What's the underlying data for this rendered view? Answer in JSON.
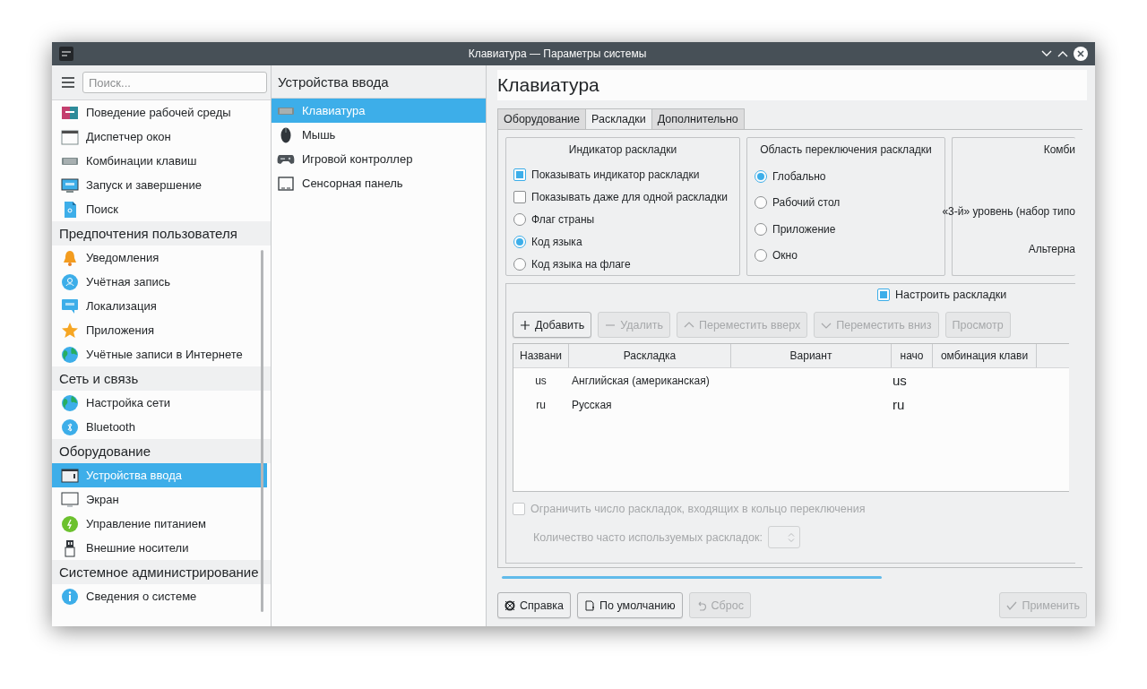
{
  "window": {
    "title": "Клавиатура — Параметры системы"
  },
  "sidebar": {
    "search": {
      "placeholder": "Поиск..."
    },
    "items": [
      {
        "kind": "item",
        "label": "Поведение рабочей среды",
        "selected": false
      },
      {
        "kind": "item",
        "label": "Диспетчер окон",
        "selected": false
      },
      {
        "kind": "item",
        "label": "Комбинации клавиш",
        "selected": false
      },
      {
        "kind": "item",
        "label": "Запуск и завершение",
        "selected": false
      },
      {
        "kind": "item",
        "label": "Поиск",
        "selected": false
      },
      {
        "kind": "category",
        "label": "Предпочтения пользователя"
      },
      {
        "kind": "item",
        "label": "Уведомления",
        "selected": false
      },
      {
        "kind": "item",
        "label": "Учётная запись",
        "selected": false
      },
      {
        "kind": "item",
        "label": "Локализация",
        "selected": false
      },
      {
        "kind": "item",
        "label": "Приложения",
        "selected": false
      },
      {
        "kind": "item",
        "label": "Учётные записи в Интернете",
        "selected": false
      },
      {
        "kind": "category",
        "label": "Сеть и связь"
      },
      {
        "kind": "item",
        "label": "Настройка сети",
        "selected": false
      },
      {
        "kind": "item",
        "label": "Bluetooth",
        "selected": false
      },
      {
        "kind": "category",
        "label": "Оборудование"
      },
      {
        "kind": "item",
        "label": "Устройства ввода",
        "selected": true
      },
      {
        "kind": "item",
        "label": "Экран",
        "selected": false
      },
      {
        "kind": "item",
        "label": "Управление питанием",
        "selected": false
      },
      {
        "kind": "item",
        "label": "Внешние носители",
        "selected": false
      },
      {
        "kind": "category",
        "label": "Системное администрирование"
      },
      {
        "kind": "item",
        "label": "Сведения о системе",
        "selected": false
      }
    ]
  },
  "subcategory": {
    "title": "Устройства ввода",
    "items": [
      {
        "label": "Клавиатура",
        "selected": true
      },
      {
        "label": "Мышь",
        "selected": false
      },
      {
        "label": "Игровой контроллер",
        "selected": false
      },
      {
        "label": "Сенсорная панель",
        "selected": false
      }
    ]
  },
  "page": {
    "title": "Клавиатура",
    "tabs": [
      {
        "label": "Оборудование",
        "selected": false
      },
      {
        "label": "Раскладки",
        "selected": true
      },
      {
        "label": "Дополнительно",
        "selected": false
      }
    ],
    "indicator_group": {
      "title": "Индикатор раскладки",
      "options": [
        {
          "kind": "checkbox",
          "label": "Показывать индикатор раскладки",
          "checked": true
        },
        {
          "kind": "checkbox",
          "label": "Показывать даже для одной раскладки",
          "checked": false
        },
        {
          "kind": "radio",
          "label": "Флаг страны",
          "selected": false
        },
        {
          "kind": "radio",
          "label": "Код языка",
          "selected": true
        },
        {
          "kind": "radio",
          "label": "Код языка на флаге",
          "selected": false
        }
      ]
    },
    "switching_group": {
      "title": "Область переключения раскладки",
      "options": [
        {
          "label": "Глобально",
          "selected": true
        },
        {
          "label": "Рабочий стол",
          "selected": false
        },
        {
          "label": "Приложение",
          "selected": false
        },
        {
          "label": "Окно",
          "selected": false
        }
      ]
    },
    "shortcuts_group": {
      "title": "Комби",
      "rows": [
        "«3-й» уровень (набор типо",
        "Альтерна"
      ]
    },
    "layouts": {
      "configure": {
        "label": "Настроить раскладки",
        "checked": true
      },
      "buttons": [
        {
          "label": "Добавить",
          "disabled": false
        },
        {
          "label": "Удалить",
          "disabled": true
        },
        {
          "label": "Переместить вверх",
          "disabled": true
        },
        {
          "label": "Переместить вниз",
          "disabled": true
        },
        {
          "label": "Просмотр",
          "disabled": true
        }
      ],
      "table": {
        "columns": [
          "Названи",
          "Раскладка",
          "Вариант",
          "начо",
          "омбинация клави"
        ],
        "rows": [
          {
            "name": "us",
            "layout": "Английская (американская)",
            "label": "us"
          },
          {
            "name": "ru",
            "layout": "Русская",
            "label": "ru"
          }
        ]
      },
      "limit": {
        "label": "Ограничить число раскладок, входящих в кольцо переключения",
        "checked": false,
        "disabled": true
      },
      "count": {
        "label": "Количество часто используемых раскладок:",
        "disabled": true
      }
    }
  },
  "buttons": [
    {
      "label": "Справка",
      "disabled": false
    },
    {
      "label": "По умолчанию",
      "disabled": false
    },
    {
      "label": "Сброс",
      "disabled": true
    },
    {
      "label": "Применить",
      "disabled": true
    }
  ]
}
